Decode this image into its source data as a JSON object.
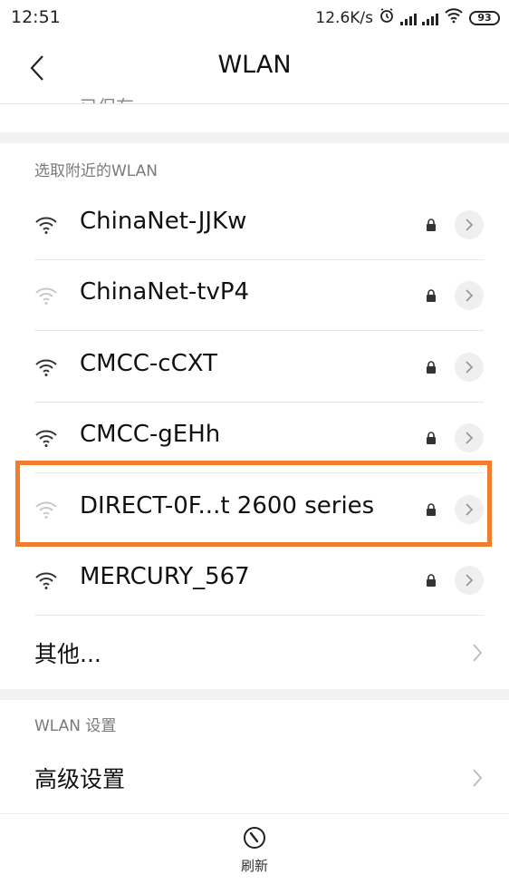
{
  "status_bar": {
    "time": "12:51",
    "speed": "12.6K/s",
    "battery": "93"
  },
  "header": {
    "title": "WLAN",
    "saved_peek": "已保存"
  },
  "nearby": {
    "section_label": "选取附近的WLAN",
    "networks": [
      {
        "ssid": "ChinaNet-JJKw",
        "signal": "strong",
        "locked": true
      },
      {
        "ssid": "ChinaNet-tvP4",
        "signal": "weak",
        "locked": true
      },
      {
        "ssid": "CMCC-cCXT",
        "signal": "strong",
        "locked": true
      },
      {
        "ssid": "CMCC-gEHh",
        "signal": "strong",
        "locked": true
      },
      {
        "ssid": "DIRECT-0F...t 2600 series",
        "signal": "weak",
        "locked": true,
        "highlighted": true
      },
      {
        "ssid": "MERCURY_567",
        "signal": "strong",
        "locked": true
      }
    ],
    "other_label": "其他..."
  },
  "settings": {
    "section_label": "WLAN 设置",
    "advanced_label": "高级设置"
  },
  "footer": {
    "refresh_label": "刷新"
  },
  "colors": {
    "highlight": "#f07d2e",
    "section_bg": "#f2f2f2"
  },
  "icons": [
    "back-arrow-icon",
    "wifi-icon",
    "lock-icon",
    "chevron-right-icon",
    "refresh-icon",
    "alarm-icon",
    "signal-icon",
    "battery-icon"
  ]
}
